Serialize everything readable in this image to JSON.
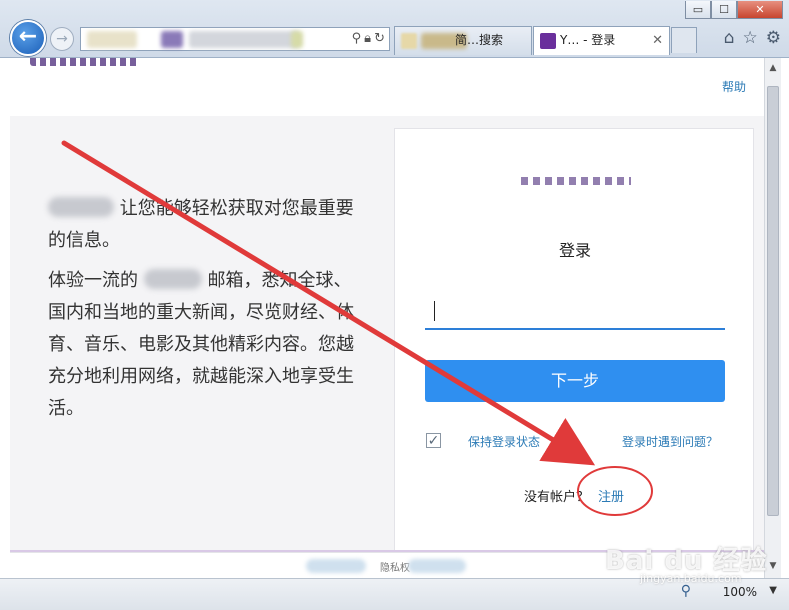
{
  "browser": {
    "window_controls": {
      "minimize": "▭",
      "maximize": "☐",
      "close": "✕"
    },
    "tabs": [
      {
        "label": "简…搜索",
        "active": false,
        "favicon_color": "#e6d8a8"
      },
      {
        "label": "Y… - 登录",
        "active": true,
        "favicon_color": "#6a2f9c"
      }
    ],
    "toolbar_icons": [
      "home-icon",
      "star-icon",
      "gear-icon"
    ],
    "zoom": "100%"
  },
  "page": {
    "header": {
      "help": "帮助"
    },
    "intro": {
      "paragraph1_tail": "让您能够轻松获取对您最重要的信息。",
      "paragraph2_head": "体验一流的",
      "paragraph2_tail": "邮箱，悉知全球、国内和当地的重大新闻，尽览财经、体育、音乐、电影及其他精彩内容。您越充分地利用网络，就越能深入地享受生活。"
    },
    "login": {
      "title": "登录",
      "username_value": "",
      "next_button": "下一步",
      "keep_signed_in": "保持登录状态",
      "trouble": "登录时遇到问题？",
      "no_account": "没有帐户？",
      "register": "注册"
    },
    "footer": {
      "privacy_fragment": "隐私权"
    }
  },
  "watermark": {
    "main": "Bai du 经验",
    "sub": "jingyan.baidu.com"
  },
  "colors": {
    "accent": "#2f8ff0",
    "link": "#2c7bb6",
    "annotation": "#e03a3a"
  }
}
